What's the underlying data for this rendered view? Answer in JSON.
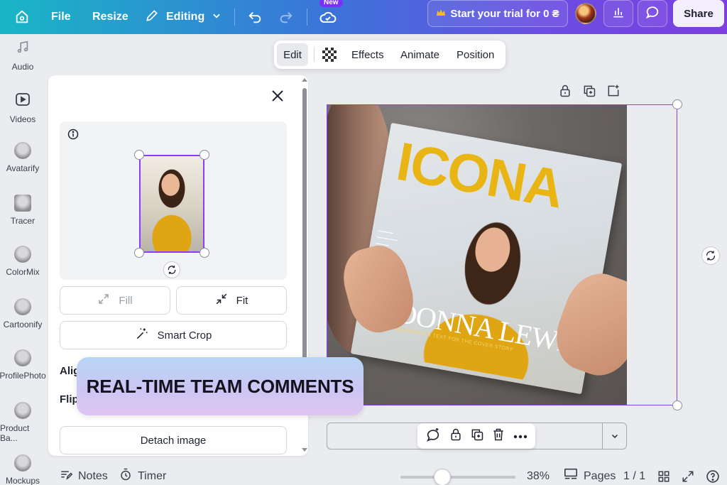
{
  "topbar": {
    "file_label": "File",
    "resize_label": "Resize",
    "editing_label": "Editing",
    "new_badge": "New",
    "trial_label": "Start your trial for 0 ₴",
    "share_label": "Share",
    "icons": [
      "home-icon",
      "pencil-icon",
      "chevron-down-icon",
      "undo-icon",
      "redo-icon",
      "cloud-check-icon",
      "crown-icon",
      "bar-chart-icon",
      "comment-icon"
    ]
  },
  "rail": {
    "items": [
      {
        "label": "Audio",
        "icon": "music-note-icon"
      },
      {
        "label": "Videos",
        "icon": "video-play-icon"
      },
      {
        "label": "Avatarify",
        "icon": "avatarify-app-icon"
      },
      {
        "label": "Tracer",
        "icon": "tracer-app-icon"
      },
      {
        "label": "ColorMix",
        "icon": "colormix-app-icon"
      },
      {
        "label": "Cartoonify",
        "icon": "cartoonify-app-icon"
      },
      {
        "label": "ProfilePhoto",
        "icon": "profilephoto-app-icon"
      },
      {
        "label": "Product Ba...",
        "icon": "product-background-app-icon"
      },
      {
        "label": "Mockups",
        "icon": "mockups-app-icon"
      }
    ]
  },
  "panel": {
    "fill_label": "Fill",
    "fit_label": "Fit",
    "smart_crop_label": "Smart Crop",
    "align_label": "Alig",
    "flip_label": "Flip",
    "detach_label": "Detach image"
  },
  "float_toolbar": {
    "edit_label": "Edit",
    "effects_label": "Effects",
    "animate_label": "Animate",
    "position_label": "Position"
  },
  "canvas": {
    "magazine_title": "ICONA",
    "magazine_name": "DONNA LEWIS",
    "magazine_subtitle": "SUPPORTING TEXT FOR THE COVER STORY"
  },
  "banner": {
    "text": "REAL-TIME TEAM COMMENTS"
  },
  "footer": {
    "notes_label": "Notes",
    "timer_label": "Timer",
    "zoom_label": "38%",
    "zoom_value": 0.38,
    "pages_label": "Pages",
    "page_count": "1 / 1"
  },
  "colors": {
    "accent_purple": "#8b3dff",
    "topbar_start": "#19b6c6",
    "topbar_end": "#7d3fe0",
    "magazine_yellow": "#e8b514"
  }
}
